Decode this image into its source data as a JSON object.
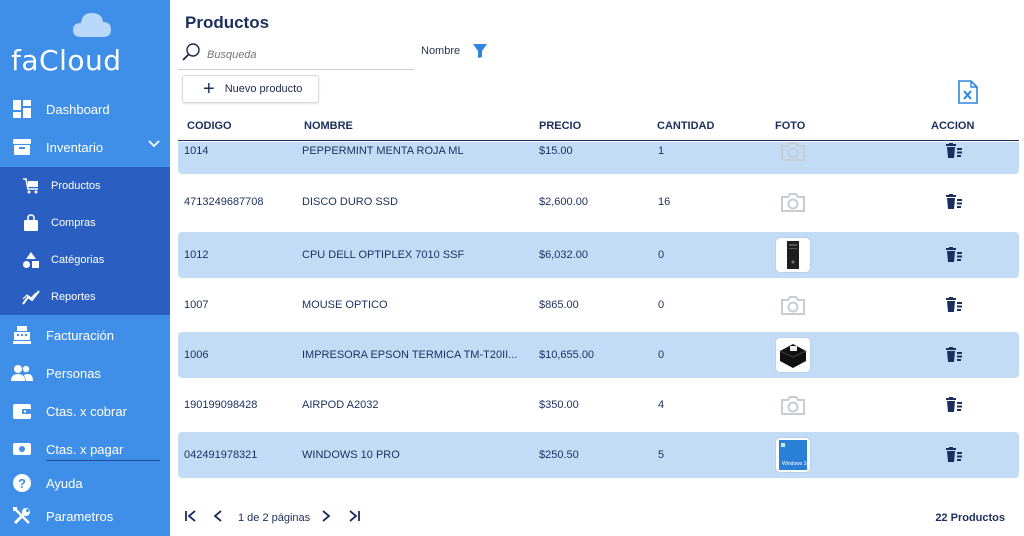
{
  "app": {
    "name": "faCloud"
  },
  "sidebar": {
    "items": [
      {
        "label": "Dashboard",
        "icon": "dashboard-icon"
      },
      {
        "label": "Inventario",
        "icon": "inventory-icon",
        "expanded": true
      },
      {
        "label": "Facturación",
        "icon": "register-icon"
      },
      {
        "label": "Personas",
        "icon": "people-icon"
      },
      {
        "label": "Ctas. x cobrar",
        "icon": "wallet-icon"
      },
      {
        "label": "Ctas. x pagar",
        "icon": "payable-icon"
      },
      {
        "label": "Ayuda",
        "icon": "help-icon"
      },
      {
        "label": "Parametros",
        "icon": "tools-icon"
      }
    ],
    "subitems": [
      {
        "label": "Productos",
        "icon": "cart-icon"
      },
      {
        "label": "Compras",
        "icon": "bag-icon"
      },
      {
        "label": "Catégorias",
        "icon": "shapes-icon"
      },
      {
        "label": "Reportes",
        "icon": "chart-icon"
      }
    ]
  },
  "page": {
    "title": "Productos",
    "search_placeholder": "Busqueda",
    "filter_label": "Nombre",
    "new_button": "Nuevo producto"
  },
  "table": {
    "headers": [
      "CODIGO",
      "NOMBRE",
      "PRECIO",
      "CANTIDAD",
      "FOTO",
      "ACCION"
    ],
    "rows": [
      {
        "code": "1014",
        "name": "PEPPERMINT MENTA ROJA ML",
        "price": "$15.00",
        "qty": "1",
        "photo": "camera-placeholder"
      },
      {
        "code": "4713249687708",
        "name": "DISCO DURO SSD",
        "price": "$2,600.00",
        "qty": "16",
        "photo": "camera-placeholder"
      },
      {
        "code": "1012",
        "name": "CPU DELL OPTIPLEX  7010 SSF",
        "price": "$6,032.00",
        "qty": "0",
        "photo": "pc-tower"
      },
      {
        "code": "1007",
        "name": "MOUSE OPTICO",
        "price": "$865.00",
        "qty": "0",
        "photo": "camera-placeholder"
      },
      {
        "code": "1006",
        "name": "IMPRESORA EPSON TERMICA TM-T20II...",
        "price": "$10,655.00",
        "qty": "0",
        "photo": "printer"
      },
      {
        "code": "190199098428",
        "name": "AIRPOD A2032",
        "price": "$350.00",
        "qty": "4",
        "photo": "camera-placeholder"
      },
      {
        "code": "042491978321",
        "name": "WINDOWS 10 PRO",
        "price": "$250.50",
        "qty": "5",
        "photo": "windows-box"
      }
    ]
  },
  "pager": {
    "info": "1 de 2 páginas",
    "count": "22 Productos"
  },
  "colors": {
    "sidebar": "#3f8fe8",
    "submenu": "#2a5fc1",
    "row_alt": "#c3dcf6",
    "text_dark": "#1b2f5e",
    "accent": "#2f86de"
  }
}
